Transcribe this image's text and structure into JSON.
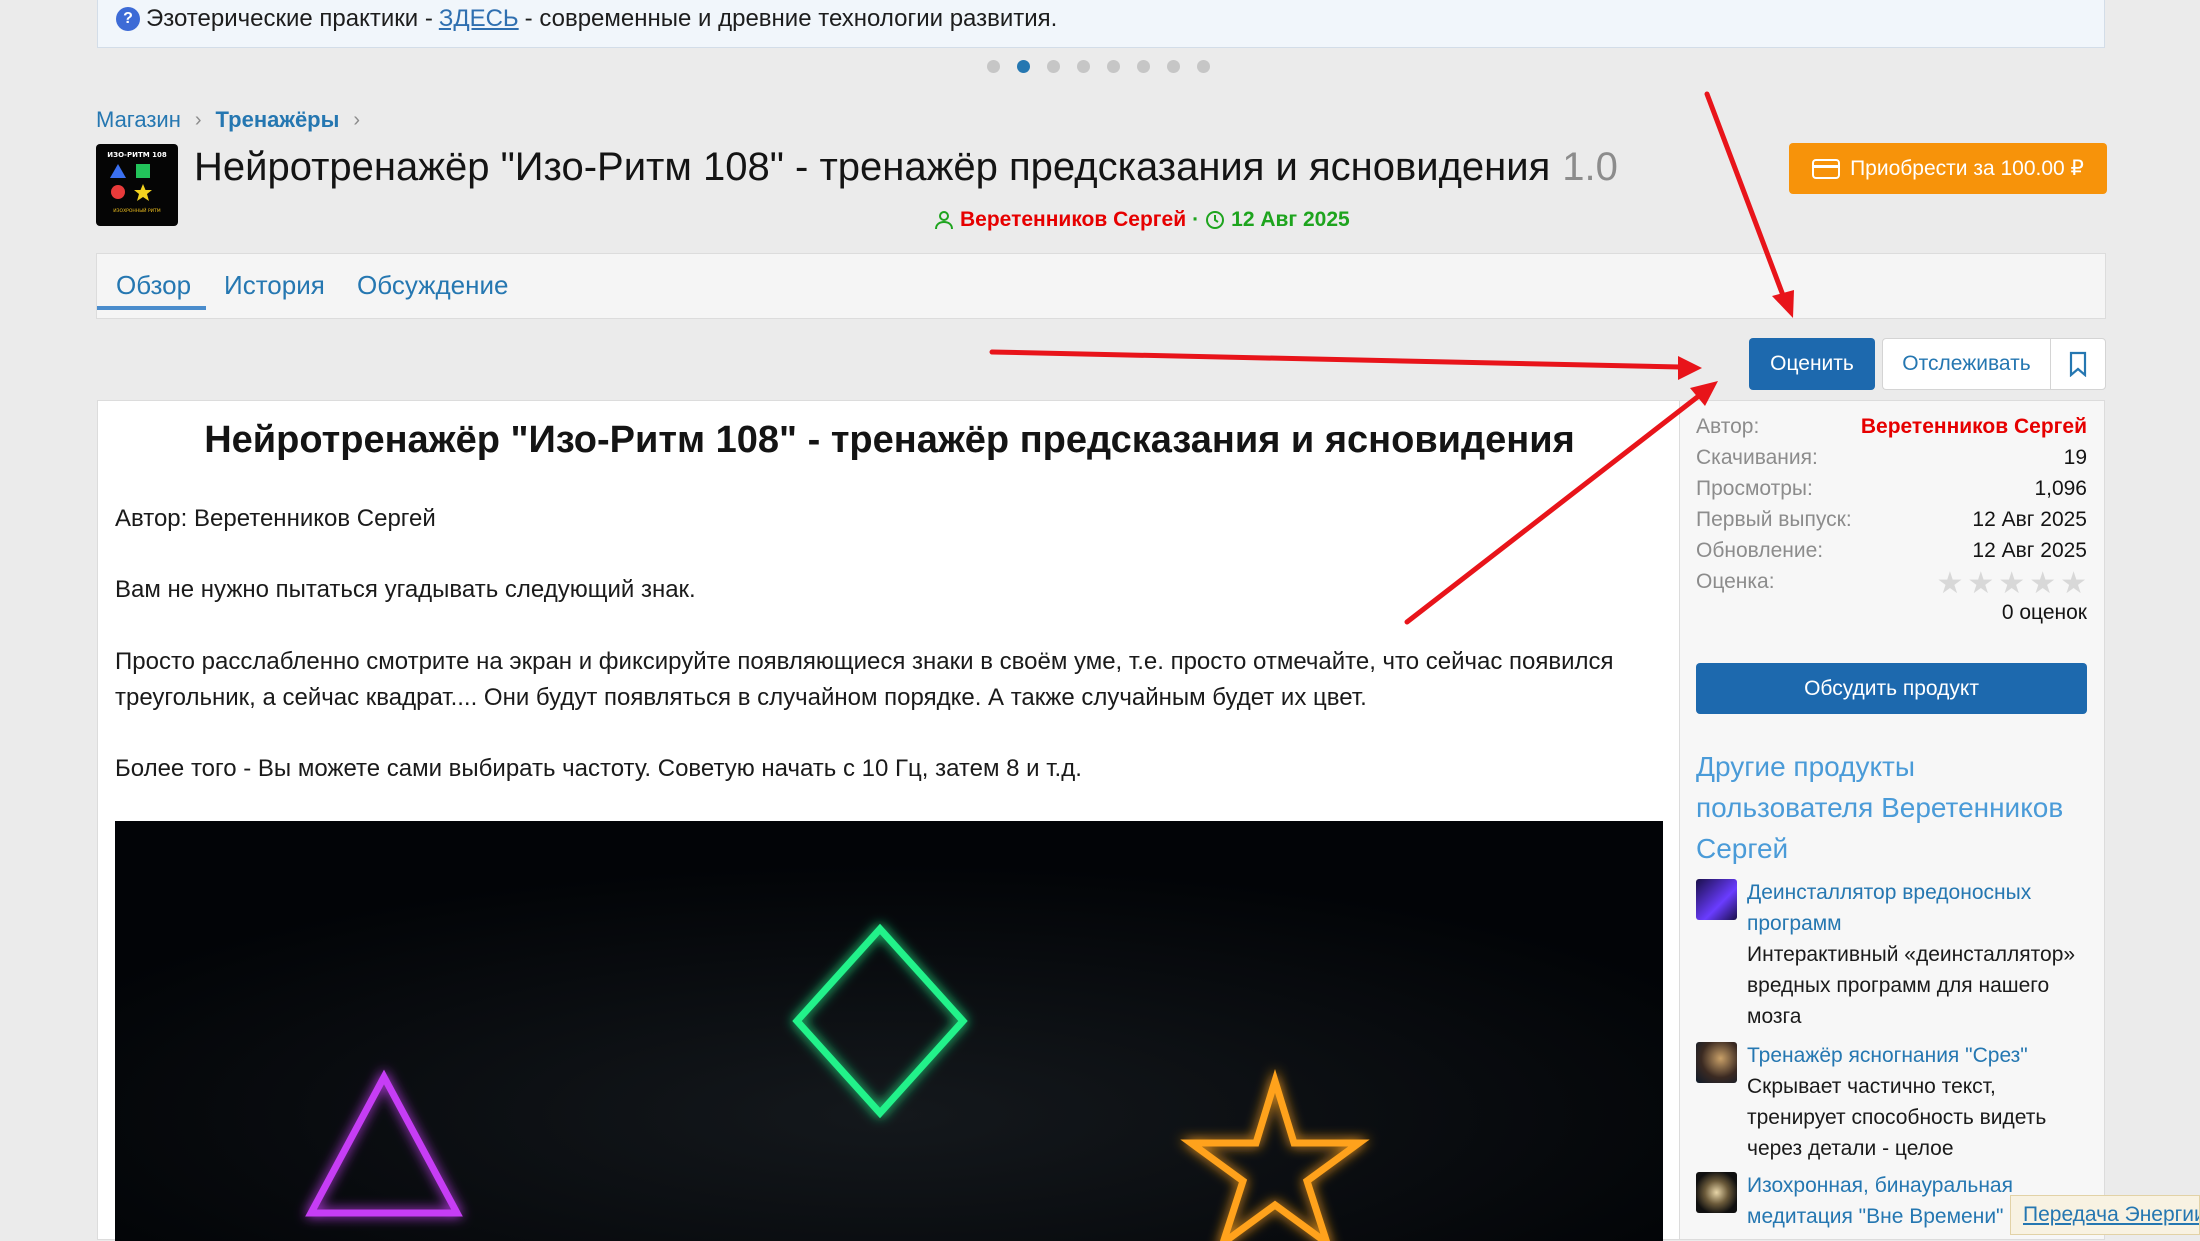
{
  "banner": {
    "prefix": "Эзотерические практики -",
    "link": "ЗДЕСЬ",
    "suffix": "- современные и древние технологии развития."
  },
  "carousel": {
    "count": 8,
    "active_index": 1
  },
  "breadcrumb": {
    "items": [
      "Магазин",
      "Тренажёры"
    ]
  },
  "product": {
    "title": "Нейротренажёр \"Изо-Ритм 108\" - тренажёр предсказания и ясновидения",
    "version": "1.0",
    "author": "Веретенников Сергей",
    "separator": "·",
    "date": "12 Авг 2025",
    "logo_text": "ИЗО-РИТМ 108"
  },
  "buy_button": "Приобрести за 100.00 ₽",
  "tabs": [
    "Обзор",
    "История",
    "Обсуждение"
  ],
  "actions": {
    "rate": "Оценить",
    "follow": "Отслеживать"
  },
  "content": {
    "heading": "Нейротренажёр \"Изо-Ритм 108\" - тренажёр предсказания и ясновидения",
    "paragraphs": [
      "Автор: Веретенников Сергей",
      "Вам не нужно пытаться угадывать следующий знак.",
      "Просто расслабленно смотрите на экран и фиксируйте появляющиеся знаки в своём уме, т.е. просто отмечайте, что сейчас появился треугольник, а сейчас квадрат.... Они будут появляться в случайном порядке. А также случайным будет их цвет.",
      "Более того - Вы можете сами выбирать частоту. Советую начать с 10 Гц, затем 8 и т.д."
    ]
  },
  "sidebar": {
    "info": [
      {
        "label": "Автор:",
        "value": "Веретенников Сергей"
      },
      {
        "label": "Скачивания:",
        "value": "19"
      },
      {
        "label": "Просмотры:",
        "value": "1,096"
      },
      {
        "label": "Первый выпуск:",
        "value": "12 Авг 2025"
      },
      {
        "label": "Обновление:",
        "value": "12 Авг 2025"
      },
      {
        "label": "Оценка:",
        "value": ""
      }
    ],
    "rating": {
      "stars": 0,
      "max": 5,
      "count_text": "0 оценок"
    },
    "discuss_button": "Обсудить продукт",
    "others_title": "Другие продукты пользователя Веретенников Сергей",
    "products": [
      {
        "title": "Деинсталлятор вредоносных программ",
        "desc": "Интерактивный «деинсталлятор» вредных программ для нашего мозга"
      },
      {
        "title": "Тренажёр ясногнания \"Срез\"",
        "desc": "Скрывает частично текст, тренирует способность видеть через детали - целое"
      },
      {
        "title": "Изохронная, бинауральная медитация \"Вне Времени\"",
        "desc": ""
      }
    ]
  },
  "toast": "Передача Энергии",
  "colors": {
    "accent": "#2577b1",
    "buy": "#f7930a",
    "primary_button": "#1d69ae",
    "author_red": "#e60000",
    "meta_green": "#1ea41e",
    "arrow_red": "#e8141a"
  }
}
